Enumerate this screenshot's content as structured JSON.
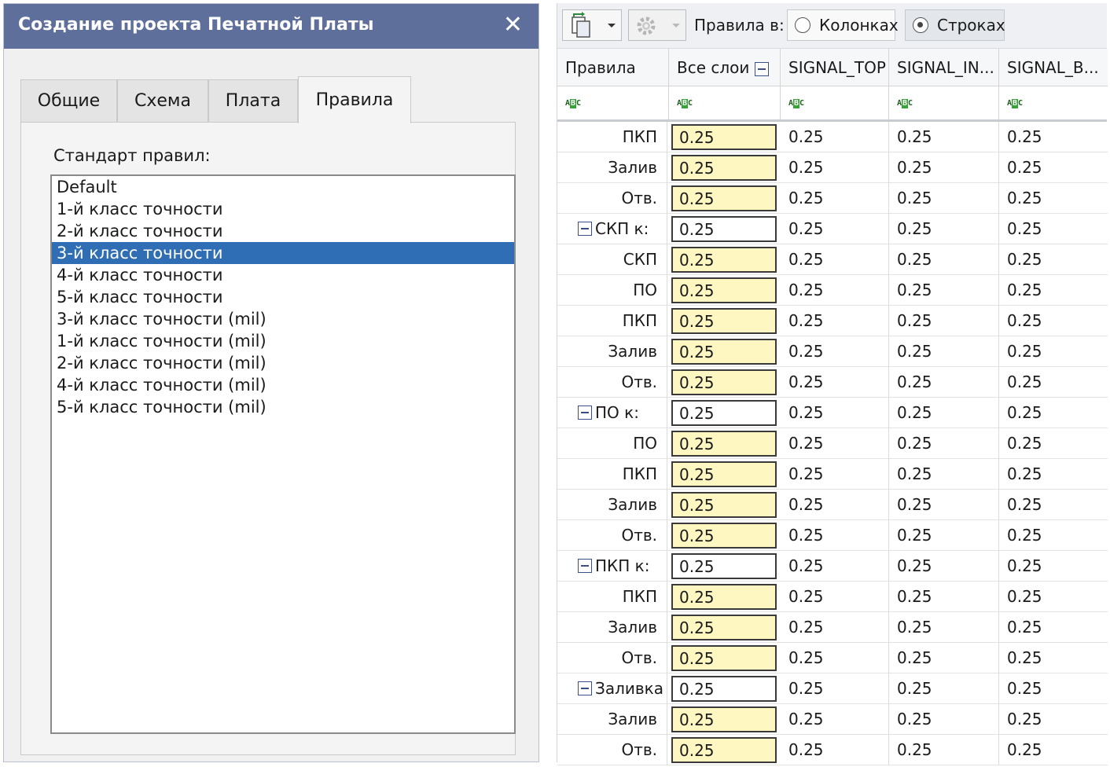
{
  "dialog": {
    "title": "Создание проекта Печатной Платы",
    "close_glyph": "✕",
    "tabs": [
      {
        "label": "Общие"
      },
      {
        "label": "Схема"
      },
      {
        "label": "Плата"
      },
      {
        "label": "Правила"
      }
    ],
    "active_tab": "Правила",
    "standard_label": "Стандарт правил:",
    "standards": [
      {
        "label": "Default"
      },
      {
        "label": "1-й класс точности"
      },
      {
        "label": "2-й класс точности"
      },
      {
        "label": "3-й класс точности"
      },
      {
        "label": "4-й класс точности"
      },
      {
        "label": "5-й класс точности"
      },
      {
        "label": "3-й класс точности (mil)"
      },
      {
        "label": "1-й класс точности (mil)"
      },
      {
        "label": "2-й класс точности (mil)"
      },
      {
        "label": "4-й класс точности (mil)"
      },
      {
        "label": "5-й класс точности (mil)"
      }
    ],
    "selected_standard": "3-й класс точности"
  },
  "toolbar": {
    "rules_in_label": "Правила в:",
    "radio_columns": "Колонках",
    "radio_rows": "Строках",
    "selected_radio": "rows",
    "icons": [
      "copy-layers-icon",
      "dropdown-arrow-icon",
      "gear-icon",
      "dropdown-arrow-icon"
    ]
  },
  "grid": {
    "headers": [
      "Правила",
      "Все слои",
      "SIGNAL_TOP",
      "SIGNAL_IN...",
      "SIGNAL_B..."
    ],
    "filter_icon": "abc-filter-icon",
    "rows": [
      {
        "name": "ПКП",
        "group": false,
        "all": "0.25",
        "v1": "0.25",
        "v2": "0.25",
        "v3": "0.25"
      },
      {
        "name": "Залив",
        "group": false,
        "all": "0.25",
        "v1": "0.25",
        "v2": "0.25",
        "v3": "0.25"
      },
      {
        "name": "Отв.",
        "group": false,
        "all": "0.25",
        "v1": "0.25",
        "v2": "0.25",
        "v3": "0.25"
      },
      {
        "name": "СКП к:",
        "group": true,
        "all": "0.25",
        "v1": "0.25",
        "v2": "0.25",
        "v3": "0.25"
      },
      {
        "name": "СКП",
        "group": false,
        "all": "0.25",
        "v1": "0.25",
        "v2": "0.25",
        "v3": "0.25"
      },
      {
        "name": "ПО",
        "group": false,
        "all": "0.25",
        "v1": "0.25",
        "v2": "0.25",
        "v3": "0.25"
      },
      {
        "name": "ПКП",
        "group": false,
        "all": "0.25",
        "v1": "0.25",
        "v2": "0.25",
        "v3": "0.25"
      },
      {
        "name": "Залив",
        "group": false,
        "all": "0.25",
        "v1": "0.25",
        "v2": "0.25",
        "v3": "0.25"
      },
      {
        "name": "Отв.",
        "group": false,
        "all": "0.25",
        "v1": "0.25",
        "v2": "0.25",
        "v3": "0.25"
      },
      {
        "name": "ПО к:",
        "group": true,
        "all": "0.25",
        "v1": "0.25",
        "v2": "0.25",
        "v3": "0.25"
      },
      {
        "name": "ПО",
        "group": false,
        "all": "0.25",
        "v1": "0.25",
        "v2": "0.25",
        "v3": "0.25"
      },
      {
        "name": "ПКП",
        "group": false,
        "all": "0.25",
        "v1": "0.25",
        "v2": "0.25",
        "v3": "0.25"
      },
      {
        "name": "Залив",
        "group": false,
        "all": "0.25",
        "v1": "0.25",
        "v2": "0.25",
        "v3": "0.25"
      },
      {
        "name": "Отв.",
        "group": false,
        "all": "0.25",
        "v1": "0.25",
        "v2": "0.25",
        "v3": "0.25"
      },
      {
        "name": "ПКП к:",
        "group": true,
        "all": "0.25",
        "v1": "0.25",
        "v2": "0.25",
        "v3": "0.25"
      },
      {
        "name": "ПКП",
        "group": false,
        "all": "0.25",
        "v1": "0.25",
        "v2": "0.25",
        "v3": "0.25"
      },
      {
        "name": "Залив",
        "group": false,
        "all": "0.25",
        "v1": "0.25",
        "v2": "0.25",
        "v3": "0.25"
      },
      {
        "name": "Отв.",
        "group": false,
        "all": "0.25",
        "v1": "0.25",
        "v2": "0.25",
        "v3": "0.25"
      },
      {
        "name": "Заливка",
        "group": true,
        "all": "0.25",
        "v1": "0.25",
        "v2": "0.25",
        "v3": "0.25"
      },
      {
        "name": "Залив",
        "group": false,
        "all": "0.25",
        "v1": "0.25",
        "v2": "0.25",
        "v3": "0.25"
      },
      {
        "name": "Отв.",
        "group": false,
        "all": "0.25",
        "v1": "0.25",
        "v2": "0.25",
        "v3": "0.25"
      }
    ]
  },
  "colors": {
    "titlebar": "#5f6f9c",
    "selection": "#2f6db5",
    "edit_cell": "#fff7c2",
    "filter_green": "#36a336"
  }
}
